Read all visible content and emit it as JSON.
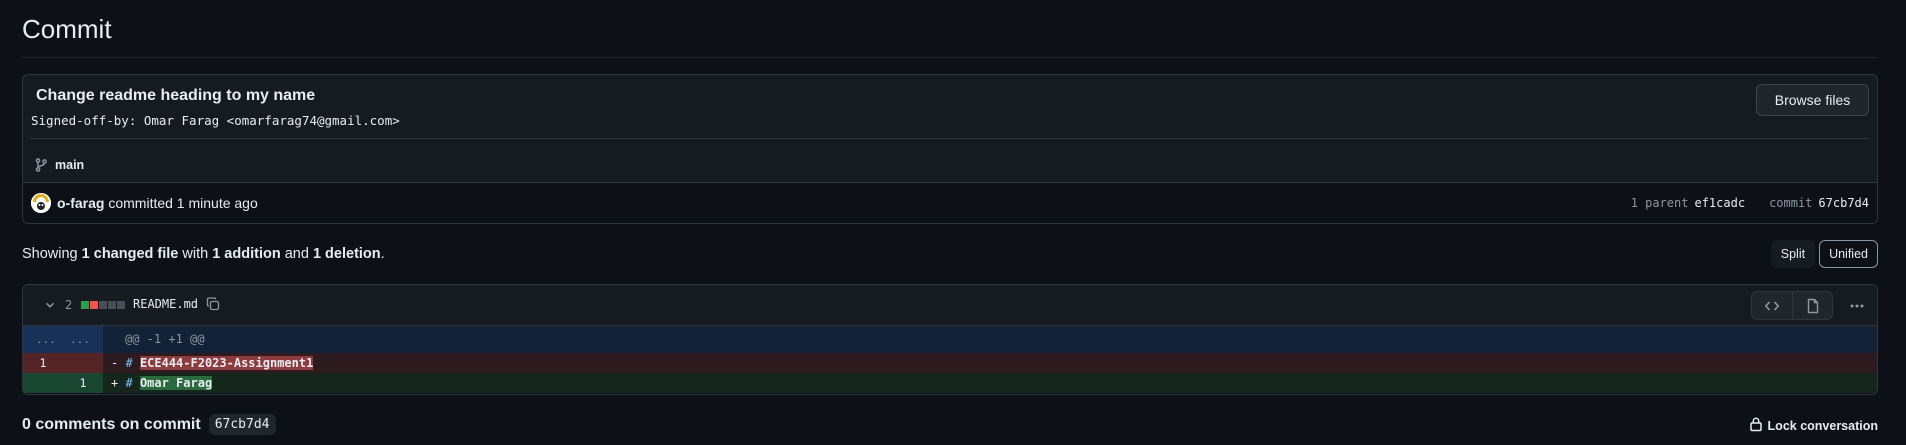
{
  "page": {
    "title": "Commit"
  },
  "commit": {
    "title": "Change readme heading to my name",
    "description": "Signed-off-by: Omar Farag <omarfarag74@gmail.com>",
    "browse_label": "Browse files",
    "branch": "main",
    "author": "o-farag",
    "action_text": "committed 1 minute ago",
    "parent_label": "1 parent",
    "parent_sha": "ef1cadc",
    "commit_label": "commit",
    "commit_sha": "67cb7d4"
  },
  "summary": {
    "prefix": "Showing",
    "files": "1 changed file",
    "with": "with",
    "additions": "1 addition",
    "and": "and",
    "deletions": "1 deletion",
    "end": "."
  },
  "view_toggle": {
    "split": "Split",
    "unified": "Unified",
    "selected": "Unified"
  },
  "diff": {
    "change_count": "2",
    "filename": "README.md",
    "hunk_gutter_left": "...",
    "hunk_gutter_right": "...",
    "hunk_header": "@@ -1 +1 @@",
    "deleted_line": {
      "number": "1",
      "sign": "-",
      "hash": "#",
      "text": "ECE444-F2023-Assignment1"
    },
    "added_line": {
      "number": "1",
      "sign": "+",
      "hash": "#",
      "text": "Omar Farag"
    }
  },
  "comments": {
    "title": "0 comments on commit",
    "sha": "67cb7d4",
    "lock_label": "Lock conversation"
  },
  "colors": {
    "background": "#0d1117",
    "addition": "#2ea043",
    "deletion": "#f85149",
    "neutral": "#484f58"
  },
  "icons": [
    "git-branch-icon",
    "avatar",
    "chevron-down-icon",
    "copy-icon",
    "code-icon",
    "file-icon",
    "kebab-icon",
    "lock-icon"
  ]
}
